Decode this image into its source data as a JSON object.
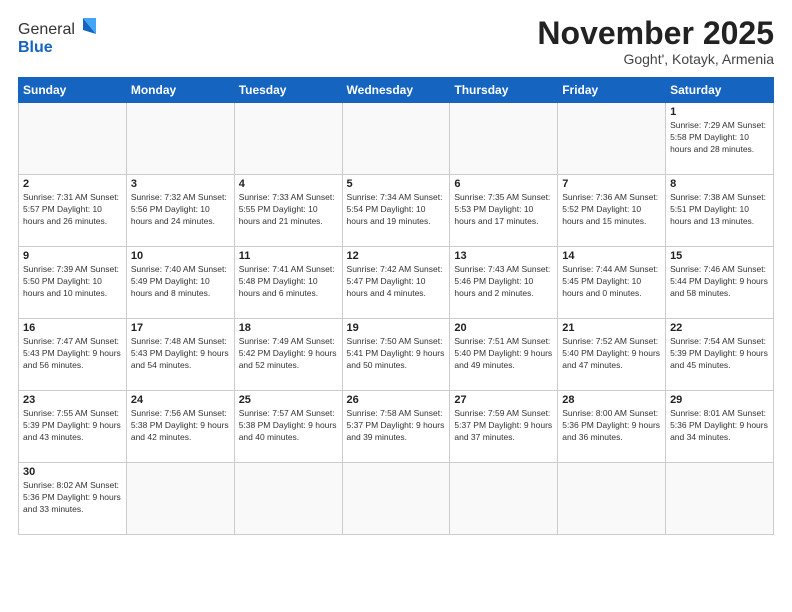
{
  "header": {
    "logo": {
      "general": "General",
      "blue": "Blue"
    },
    "title": "November 2025",
    "subtitle": "Goght', Kotayk, Armenia"
  },
  "weekdays": [
    "Sunday",
    "Monday",
    "Tuesday",
    "Wednesday",
    "Thursday",
    "Friday",
    "Saturday"
  ],
  "weeks": [
    [
      {
        "day": "",
        "info": ""
      },
      {
        "day": "",
        "info": ""
      },
      {
        "day": "",
        "info": ""
      },
      {
        "day": "",
        "info": ""
      },
      {
        "day": "",
        "info": ""
      },
      {
        "day": "",
        "info": ""
      },
      {
        "day": "1",
        "info": "Sunrise: 7:29 AM\nSunset: 5:58 PM\nDaylight: 10 hours and 28 minutes."
      }
    ],
    [
      {
        "day": "2",
        "info": "Sunrise: 7:31 AM\nSunset: 5:57 PM\nDaylight: 10 hours and 26 minutes."
      },
      {
        "day": "3",
        "info": "Sunrise: 7:32 AM\nSunset: 5:56 PM\nDaylight: 10 hours and 24 minutes."
      },
      {
        "day": "4",
        "info": "Sunrise: 7:33 AM\nSunset: 5:55 PM\nDaylight: 10 hours and 21 minutes."
      },
      {
        "day": "5",
        "info": "Sunrise: 7:34 AM\nSunset: 5:54 PM\nDaylight: 10 hours and 19 minutes."
      },
      {
        "day": "6",
        "info": "Sunrise: 7:35 AM\nSunset: 5:53 PM\nDaylight: 10 hours and 17 minutes."
      },
      {
        "day": "7",
        "info": "Sunrise: 7:36 AM\nSunset: 5:52 PM\nDaylight: 10 hours and 15 minutes."
      },
      {
        "day": "8",
        "info": "Sunrise: 7:38 AM\nSunset: 5:51 PM\nDaylight: 10 hours and 13 minutes."
      }
    ],
    [
      {
        "day": "9",
        "info": "Sunrise: 7:39 AM\nSunset: 5:50 PM\nDaylight: 10 hours and 10 minutes."
      },
      {
        "day": "10",
        "info": "Sunrise: 7:40 AM\nSunset: 5:49 PM\nDaylight: 10 hours and 8 minutes."
      },
      {
        "day": "11",
        "info": "Sunrise: 7:41 AM\nSunset: 5:48 PM\nDaylight: 10 hours and 6 minutes."
      },
      {
        "day": "12",
        "info": "Sunrise: 7:42 AM\nSunset: 5:47 PM\nDaylight: 10 hours and 4 minutes."
      },
      {
        "day": "13",
        "info": "Sunrise: 7:43 AM\nSunset: 5:46 PM\nDaylight: 10 hours and 2 minutes."
      },
      {
        "day": "14",
        "info": "Sunrise: 7:44 AM\nSunset: 5:45 PM\nDaylight: 10 hours and 0 minutes."
      },
      {
        "day": "15",
        "info": "Sunrise: 7:46 AM\nSunset: 5:44 PM\nDaylight: 9 hours and 58 minutes."
      }
    ],
    [
      {
        "day": "16",
        "info": "Sunrise: 7:47 AM\nSunset: 5:43 PM\nDaylight: 9 hours and 56 minutes."
      },
      {
        "day": "17",
        "info": "Sunrise: 7:48 AM\nSunset: 5:43 PM\nDaylight: 9 hours and 54 minutes."
      },
      {
        "day": "18",
        "info": "Sunrise: 7:49 AM\nSunset: 5:42 PM\nDaylight: 9 hours and 52 minutes."
      },
      {
        "day": "19",
        "info": "Sunrise: 7:50 AM\nSunset: 5:41 PM\nDaylight: 9 hours and 50 minutes."
      },
      {
        "day": "20",
        "info": "Sunrise: 7:51 AM\nSunset: 5:40 PM\nDaylight: 9 hours and 49 minutes."
      },
      {
        "day": "21",
        "info": "Sunrise: 7:52 AM\nSunset: 5:40 PM\nDaylight: 9 hours and 47 minutes."
      },
      {
        "day": "22",
        "info": "Sunrise: 7:54 AM\nSunset: 5:39 PM\nDaylight: 9 hours and 45 minutes."
      }
    ],
    [
      {
        "day": "23",
        "info": "Sunrise: 7:55 AM\nSunset: 5:39 PM\nDaylight: 9 hours and 43 minutes."
      },
      {
        "day": "24",
        "info": "Sunrise: 7:56 AM\nSunset: 5:38 PM\nDaylight: 9 hours and 42 minutes."
      },
      {
        "day": "25",
        "info": "Sunrise: 7:57 AM\nSunset: 5:38 PM\nDaylight: 9 hours and 40 minutes."
      },
      {
        "day": "26",
        "info": "Sunrise: 7:58 AM\nSunset: 5:37 PM\nDaylight: 9 hours and 39 minutes."
      },
      {
        "day": "27",
        "info": "Sunrise: 7:59 AM\nSunset: 5:37 PM\nDaylight: 9 hours and 37 minutes."
      },
      {
        "day": "28",
        "info": "Sunrise: 8:00 AM\nSunset: 5:36 PM\nDaylight: 9 hours and 36 minutes."
      },
      {
        "day": "29",
        "info": "Sunrise: 8:01 AM\nSunset: 5:36 PM\nDaylight: 9 hours and 34 minutes."
      }
    ],
    [
      {
        "day": "30",
        "info": "Sunrise: 8:02 AM\nSunset: 5:36 PM\nDaylight: 9 hours and 33 minutes."
      },
      {
        "day": "",
        "info": ""
      },
      {
        "day": "",
        "info": ""
      },
      {
        "day": "",
        "info": ""
      },
      {
        "day": "",
        "info": ""
      },
      {
        "day": "",
        "info": ""
      },
      {
        "day": "",
        "info": ""
      }
    ]
  ]
}
